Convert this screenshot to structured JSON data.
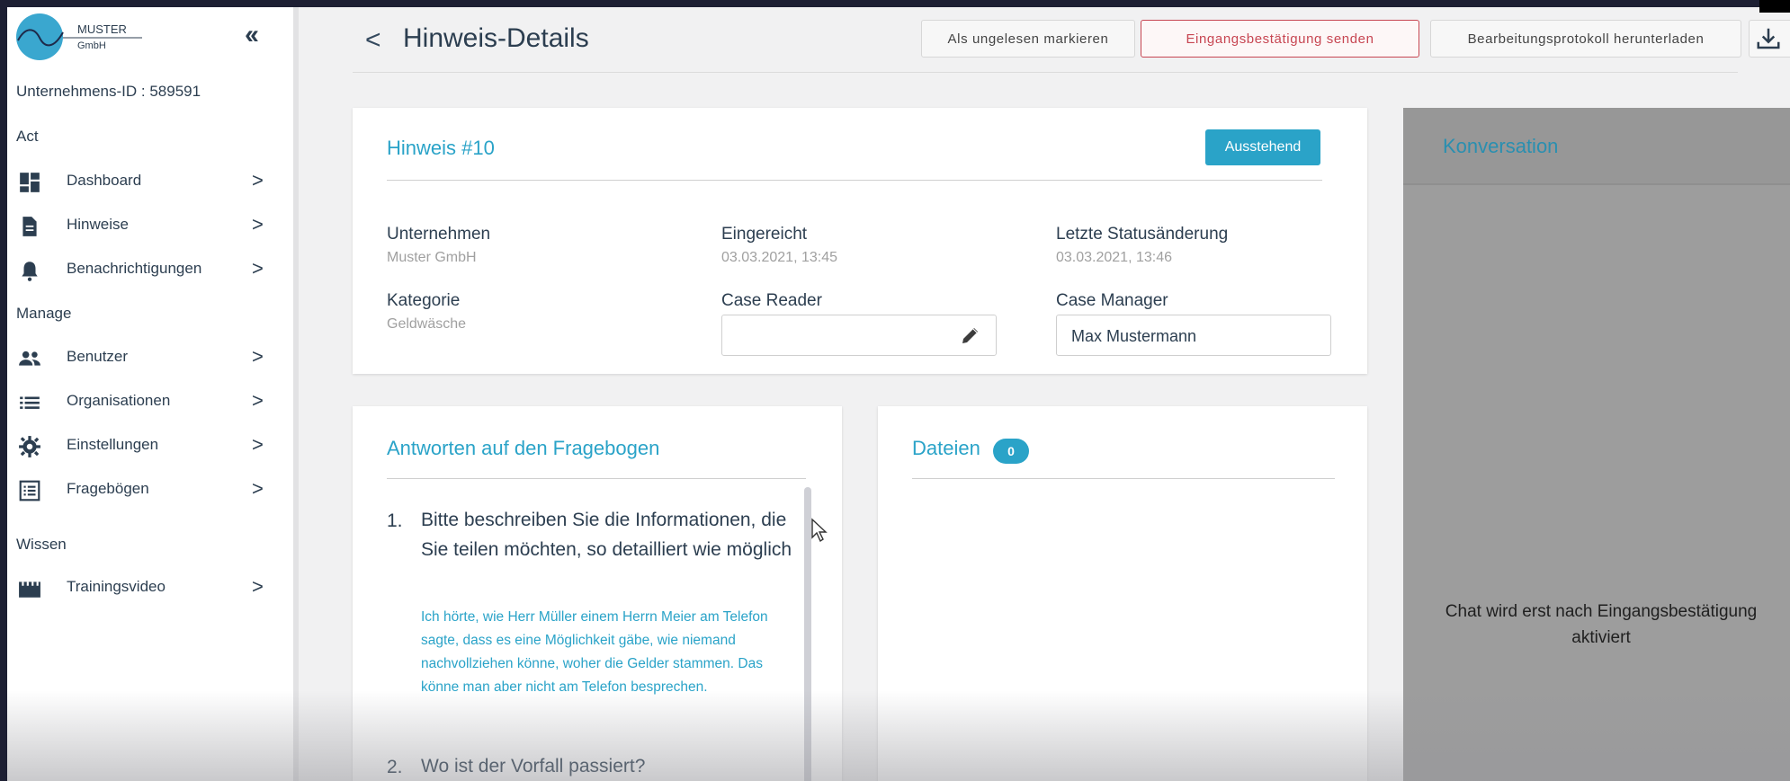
{
  "sidebar": {
    "logo_line1": "MUSTER",
    "logo_line2": "GmbH",
    "collapse_icon": "double-chevron-left",
    "company_id": "Unternehmens-ID : 589591",
    "sections": [
      "Act",
      "Manage",
      "Wissen"
    ],
    "items": [
      {
        "label": "Dashboard",
        "icon": "dashboard-icon"
      },
      {
        "label": "Hinweise",
        "icon": "document-icon"
      },
      {
        "label": "Benachrichtigungen",
        "icon": "bell-icon"
      },
      {
        "label": "Benutzer",
        "icon": "users-icon"
      },
      {
        "label": "Organisationen",
        "icon": "list-icon"
      },
      {
        "label": "Einstellungen",
        "icon": "gear-icon"
      },
      {
        "label": "Fragebögen",
        "icon": "form-icon"
      },
      {
        "label": "Trainingsvideo",
        "icon": "video-icon"
      }
    ],
    "chevron": ">"
  },
  "header": {
    "back": "<",
    "title": "Hinweis-Details",
    "buttons": {
      "mark_unread": "Als ungelesen markieren",
      "send_confirmation": "Eingangsbestätigung senden",
      "download_log": "Bearbeitungsprotokoll herunterladen"
    }
  },
  "details": {
    "title": "Hinweis #10",
    "status": "Ausstehend",
    "fields": {
      "company_label": "Unternehmen",
      "company_value": "Muster GmbH",
      "submitted_label": "Eingereicht",
      "submitted_value": "03.03.2021, 13:45",
      "last_change_label": "Letzte Statusänderung",
      "last_change_value": "03.03.2021, 13:46",
      "category_label": "Kategorie",
      "category_value": "Geldwäsche",
      "case_reader_label": "Case Reader",
      "case_reader_value": "",
      "case_manager_label": "Case Manager",
      "case_manager_value": "Max Mustermann"
    }
  },
  "questionnaire": {
    "title": "Antworten auf den Fragebogen",
    "questions": [
      {
        "num": "1.",
        "text": "Bitte beschreiben Sie die Informationen, die Sie teilen möchten, so detailliert wie möglich",
        "answer": "Ich hörte, wie Herr Müller einem Herrn Meier am Telefon sagte, dass es eine Möglichkeit gäbe, wie niemand nachvollziehen könne, woher die Gelder stammen. Das könne man aber nicht am Telefon besprechen."
      },
      {
        "num": "2.",
        "text": "Wo ist der Vorfall passiert?",
        "answer": ""
      }
    ]
  },
  "files": {
    "title": "Dateien",
    "count": "0"
  },
  "conversation": {
    "title": "Konversation",
    "message": "Chat wird erst nach Eingangsbestätigung aktiviert"
  },
  "colors": {
    "accent": "#2aa3c8",
    "danger": "#c74652",
    "text": "#2c3e50"
  }
}
